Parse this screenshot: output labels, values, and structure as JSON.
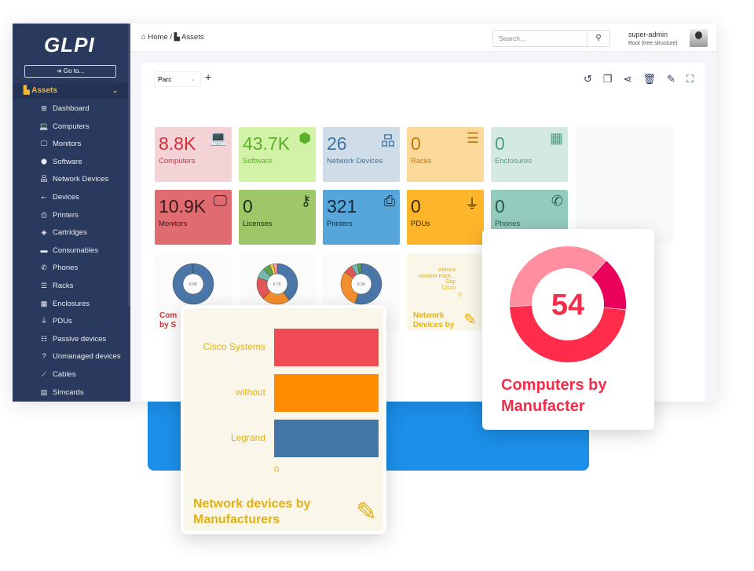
{
  "sidebar": {
    "logo": "GLPI",
    "goto": "Go to...",
    "section": "Assets",
    "items": [
      {
        "label": "Dashboard",
        "icon": "dashboard-icon",
        "glyph": "⊞"
      },
      {
        "label": "Computers",
        "icon": "laptop-icon",
        "glyph": "💻"
      },
      {
        "label": "Monitors",
        "icon": "monitor-icon",
        "glyph": "🖵"
      },
      {
        "label": "Software",
        "icon": "cube-icon",
        "glyph": "⬢"
      },
      {
        "label": "Network Devices",
        "icon": "network-icon",
        "glyph": "品"
      },
      {
        "label": "Devices",
        "icon": "usb-icon",
        "glyph": "⭠"
      },
      {
        "label": "Printers",
        "icon": "printer-icon",
        "glyph": "⎙"
      },
      {
        "label": "Cartridges",
        "icon": "fill-drip-icon",
        "glyph": "◈"
      },
      {
        "label": "Consumables",
        "icon": "boxes-icon",
        "glyph": "▬"
      },
      {
        "label": "Phones",
        "icon": "phone-icon",
        "glyph": "✆"
      },
      {
        "label": "Racks",
        "icon": "server-icon",
        "glyph": "☰"
      },
      {
        "label": "Enclosures",
        "icon": "grid-icon",
        "glyph": "▦"
      },
      {
        "label": "PDUs",
        "icon": "plug-icon",
        "glyph": "⏚"
      },
      {
        "label": "Passive devices",
        "icon": "list-icon",
        "glyph": "☷"
      },
      {
        "label": "Unmanaged devices",
        "icon": "question-icon",
        "glyph": "?"
      },
      {
        "label": "Cables",
        "icon": "cable-icon",
        "glyph": "⟋"
      },
      {
        "label": "Simcards",
        "icon": "simcard-icon",
        "glyph": "▤"
      }
    ]
  },
  "header": {
    "breadcrumb": [
      "Home",
      "/",
      "Assets"
    ],
    "search_placeholder": "Search...",
    "user": "super-admin",
    "entity": "Root (tree structure)"
  },
  "dashboard": {
    "selected": "Parc",
    "tiles": [
      {
        "value": "8.8K",
        "label": "Computers",
        "bg": "#f3d3d6",
        "fg": "#d72e3a",
        "glyph": "💻"
      },
      {
        "value": "43.7K",
        "label": "Software",
        "bg": "#d2f2a8",
        "fg": "#5aae28",
        "glyph": "⬢"
      },
      {
        "value": "26",
        "label": "Network Devices",
        "bg": "#cfdde9",
        "fg": "#3f73a3",
        "glyph": "品"
      },
      {
        "value": "0",
        "label": "Racks",
        "bg": "#fbd99b",
        "fg": "#c07b0c",
        "glyph": "☰"
      },
      {
        "value": "0",
        "label": "Enclosures",
        "bg": "#d5e9e4",
        "fg": "#4e9c86",
        "glyph": "▦"
      },
      {
        "value": "10.9K",
        "label": "Monitors",
        "bg": "#e06c72",
        "fg": "#3a1a1c",
        "glyph": "🖵"
      },
      {
        "value": "0",
        "label": "Licenses",
        "bg": "#9dc768",
        "fg": "#1f2b12",
        "glyph": "⚷"
      },
      {
        "value": "321",
        "label": "Printers",
        "bg": "#57a6d9",
        "fg": "#11263a",
        "glyph": "⎙"
      },
      {
        "value": "0",
        "label": "PDUs",
        "bg": "#fdb52a",
        "fg": "#3a2a05",
        "glyph": "⏚"
      },
      {
        "value": "0",
        "label": "Phones",
        "bg": "#93cbbd",
        "fg": "#245a4c",
        "glyph": "✆"
      }
    ],
    "minis": [
      {
        "center": "8.8K",
        "title": "Com by S"
      },
      {
        "center": "8.7K",
        "title": ""
      },
      {
        "center": "8.3K",
        "title": ""
      }
    ],
    "mini_bar": {
      "labels": [
        "without",
        "Hewlett-Pack...",
        "Digi",
        "Cisco"
      ],
      "zero": "0",
      "title": "Network Devices by"
    }
  },
  "popup_donut": {
    "value": "54",
    "title": "Computers by Manufacter",
    "colors": [
      "#ff8fa0",
      "#e8005a",
      "#ff2d4b"
    ],
    "shares": [
      37,
      15,
      48
    ]
  },
  "popup_bars": {
    "categories": [
      "Cisco Systems",
      "without",
      "Legrand"
    ],
    "colors": [
      "#f24a55",
      "#ff8c00",
      "#4476a8"
    ],
    "axis_zero": "0",
    "title": "Network devices by Manufacturers"
  }
}
